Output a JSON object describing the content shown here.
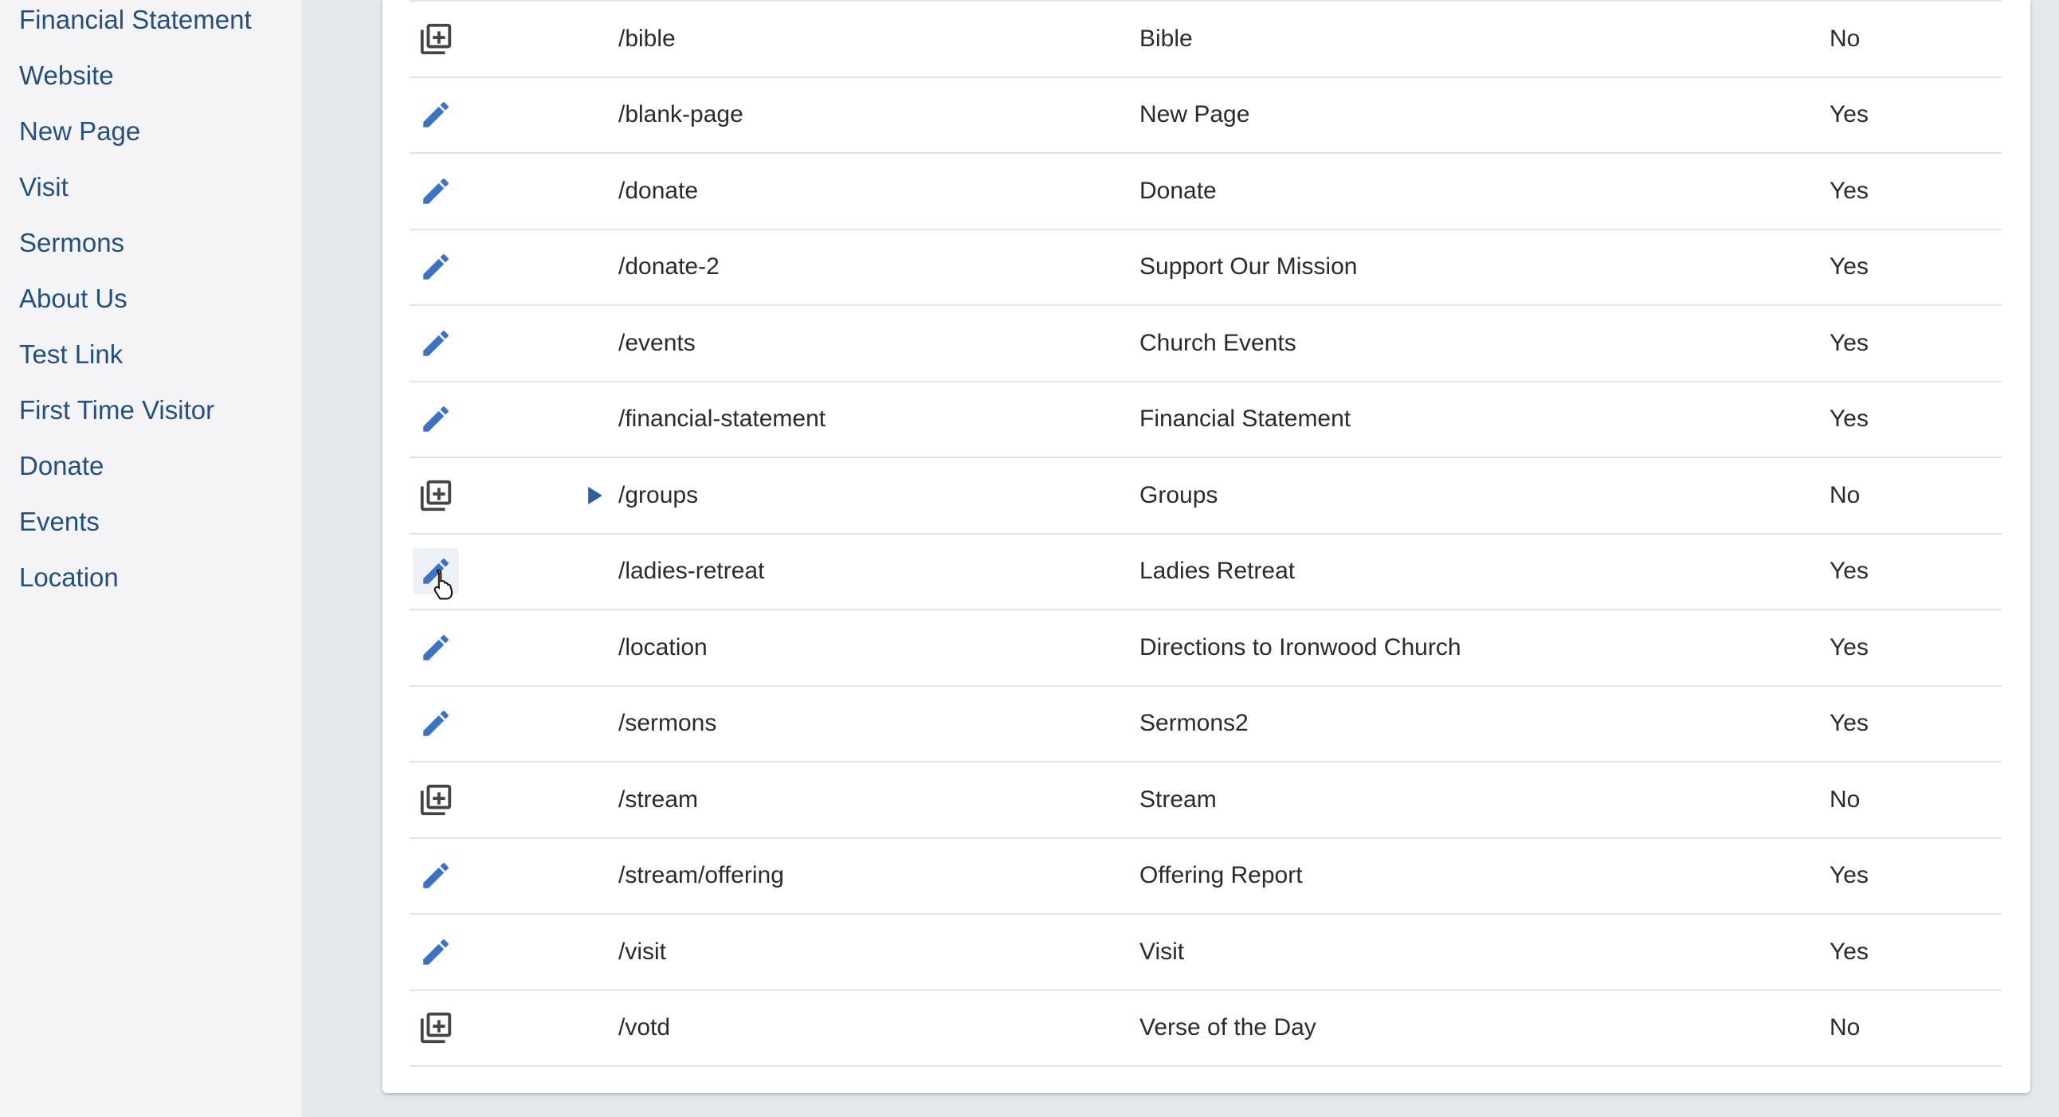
{
  "sidebar": {
    "items": [
      {
        "label": "Financial Statement"
      },
      {
        "label": "Website"
      },
      {
        "label": "New Page"
      },
      {
        "label": "Visit"
      },
      {
        "label": "Sermons"
      },
      {
        "label": "About Us"
      },
      {
        "label": "Test Link"
      },
      {
        "label": "First Time Visitor"
      },
      {
        "label": "Donate"
      },
      {
        "label": "Events"
      },
      {
        "label": "Location"
      }
    ]
  },
  "colors": {
    "accent": "#3b73c4",
    "icon_gray": "#444444",
    "sidebar_link": "#24507e",
    "background": "#e4e7ec"
  },
  "pages": {
    "rows": [
      {
        "icon": "add-document-icon",
        "has_children": false,
        "url": "/bible",
        "title": "Bible",
        "custom": "No"
      },
      {
        "icon": "edit-pencil-icon",
        "has_children": false,
        "url": "/blank-page",
        "title": "New Page",
        "custom": "Yes"
      },
      {
        "icon": "edit-pencil-icon",
        "has_children": false,
        "url": "/donate",
        "title": "Donate",
        "custom": "Yes"
      },
      {
        "icon": "edit-pencil-icon",
        "has_children": false,
        "url": "/donate-2",
        "title": "Support Our Mission",
        "custom": "Yes"
      },
      {
        "icon": "edit-pencil-icon",
        "has_children": false,
        "url": "/events",
        "title": "Church Events",
        "custom": "Yes"
      },
      {
        "icon": "edit-pencil-icon",
        "has_children": false,
        "url": "/financial-statement",
        "title": "Financial Statement",
        "custom": "Yes"
      },
      {
        "icon": "add-document-icon",
        "has_children": true,
        "url": "/groups",
        "title": "Groups",
        "custom": "No"
      },
      {
        "icon": "edit-pencil-icon",
        "has_children": false,
        "url": "/ladies-retreat",
        "title": "Ladies Retreat",
        "custom": "Yes",
        "hovered": true
      },
      {
        "icon": "edit-pencil-icon",
        "has_children": false,
        "url": "/location",
        "title": "Directions to Ironwood Church",
        "custom": "Yes"
      },
      {
        "icon": "edit-pencil-icon",
        "has_children": false,
        "url": "/sermons",
        "title": "Sermons2",
        "custom": "Yes"
      },
      {
        "icon": "add-document-icon",
        "has_children": false,
        "url": "/stream",
        "title": "Stream",
        "custom": "No"
      },
      {
        "icon": "edit-pencil-icon",
        "has_children": false,
        "url": "/stream/offering",
        "title": "Offering Report",
        "custom": "Yes"
      },
      {
        "icon": "edit-pencil-icon",
        "has_children": false,
        "url": "/visit",
        "title": "Visit",
        "custom": "Yes"
      },
      {
        "icon": "add-document-icon",
        "has_children": false,
        "url": "/votd",
        "title": "Verse of the Day",
        "custom": "No"
      }
    ]
  }
}
